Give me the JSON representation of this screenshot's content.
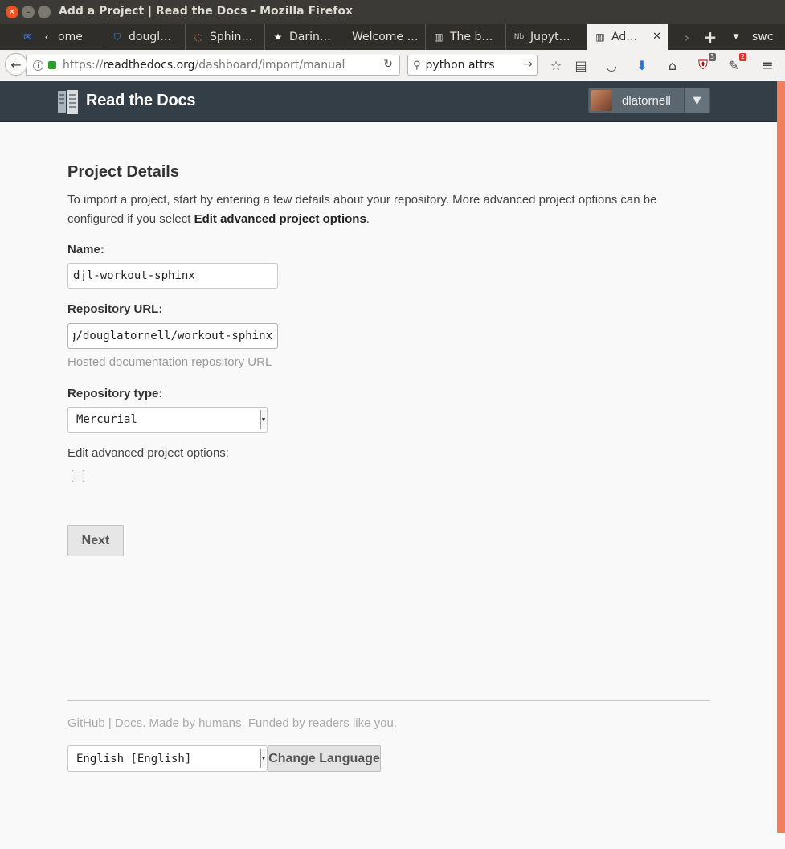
{
  "window": {
    "title": "Add a Project | Read the Docs - Mozilla Firefox"
  },
  "tabs": [
    {
      "label": "ome",
      "icon": "inbox-icon"
    },
    {
      "label": "dougl…",
      "icon": "bitbucket-icon"
    },
    {
      "label": "Sphin…",
      "icon": "sphinx-icon"
    },
    {
      "label": "Darin…",
      "icon": "star-icon"
    },
    {
      "label": "Welcome …",
      "icon": ""
    },
    {
      "label": "The b…",
      "icon": "book-icon"
    },
    {
      "label": "Jupyt…",
      "icon": "notebook-icon"
    },
    {
      "label": "Ad…",
      "icon": "book-icon"
    }
  ],
  "tabbar": {
    "overflow_label": "swc"
  },
  "navbar": {
    "url_scheme": "https://",
    "url_host": "readthedocs.org",
    "url_path": "/dashboard/import/manual",
    "search_value": "python attrs",
    "ublock_badge": "3",
    "extension_badge": "2"
  },
  "header": {
    "brand": "Read the Docs",
    "username": "dlatornell"
  },
  "form": {
    "title": "Project Details",
    "desc_prefix": "To import a project, start by entering a few details about your repository. More advanced project options can be configured if you select ",
    "desc_bold": "Edit advanced project options",
    "desc_suffix": ".",
    "name_label": "Name:",
    "name_value": "djl-workout-sphinx",
    "repo_label": "Repository URL:",
    "repo_value": "https://bitbucket.org/douglatornell/workout-sphinx",
    "repo_help": "Hosted documentation repository URL",
    "type_label": "Repository type:",
    "type_value": "Mercurial",
    "advanced_label": "Edit advanced project options:",
    "next_button": "Next"
  },
  "footer": {
    "github": "GitHub",
    "sep": " | ",
    "docs": "Docs",
    "made_by": ". Made by ",
    "humans": "humans",
    "funded_by": ". Funded by ",
    "readers": "readers like you",
    "end": ".",
    "language_value": "English [English]",
    "change_language": "Change Language"
  }
}
